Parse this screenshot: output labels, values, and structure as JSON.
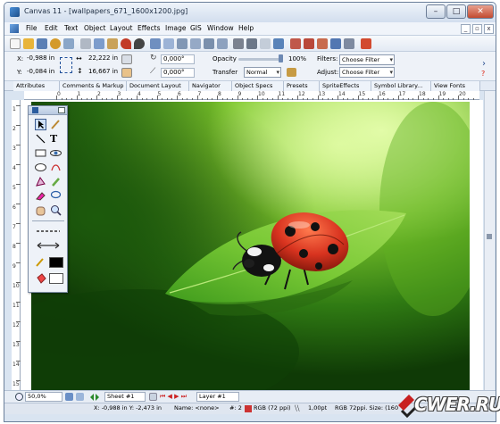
{
  "window": {
    "title": "Canvas 11 - [wallpapers_671_1600x1200.jpg]",
    "controls": {
      "minimize": "–",
      "maximize": "□",
      "close": "✕"
    }
  },
  "menu": {
    "items": [
      "File",
      "Edit",
      "Text",
      "Object",
      "Layout",
      "Effects",
      "Image",
      "GIS",
      "Window",
      "Help"
    ],
    "doc_controls": {
      "minimize": "_",
      "restore": "▫",
      "close": "x"
    }
  },
  "props": {
    "x_label": "X:",
    "x_value": "-0,988 in",
    "y_label": "Y:",
    "y_value": "-0,084 in",
    "width_value": "22,222 in",
    "height_value": "16,667 in",
    "angle1_value": "0,000°",
    "angle2_value": "0,000°",
    "opacity_label": "Opacity",
    "opacity_value": "100%",
    "opacity_level": 1.0,
    "transfer_label": "Transfer",
    "transfer_value": "Normal",
    "filters_label": "Filters:",
    "filters_value": "Choose Filter",
    "adjust_label": "Adjust:",
    "adjust_value": "Choose Filter"
  },
  "tabs": [
    "Attributes",
    "Comments & Markup",
    "Document Layout",
    "Navigator",
    "Object Specs",
    "Presets",
    "SpriteEffects",
    "Symbol Library...",
    "View Fonts"
  ],
  "ruler": {
    "top_numbers": [
      "0",
      "1",
      "2",
      "3",
      "4",
      "5",
      "6",
      "7",
      "8",
      "9",
      "10",
      "11",
      "12",
      "13",
      "14",
      "15",
      "16",
      "17",
      "18",
      "19",
      "20",
      "21"
    ],
    "left_numbers": [
      "1",
      "2",
      "3",
      "4",
      "5",
      "6",
      "7",
      "8",
      "9",
      "10",
      "11",
      "12",
      "13",
      "14",
      "15"
    ]
  },
  "status": {
    "zoom": "50,0%",
    "sheet": "Sheet #1",
    "layer": "Layer #1",
    "coords": "X: -0,988 in Y: -2,473 in",
    "name": "Name: <none>",
    "count": "#: 2",
    "color_mode": "RGB (72 ppi)",
    "stroke": "1,00pt",
    "image_info": "RGB 72ppi. Size: (160"
  },
  "watermark": {
    "text": "CWER.RU"
  },
  "colors": {
    "window_frame": "#d9e4f1",
    "accent": "#2b5c9e",
    "ladybug_red": "#d8331f",
    "leaf_green": "#6fc22a"
  }
}
